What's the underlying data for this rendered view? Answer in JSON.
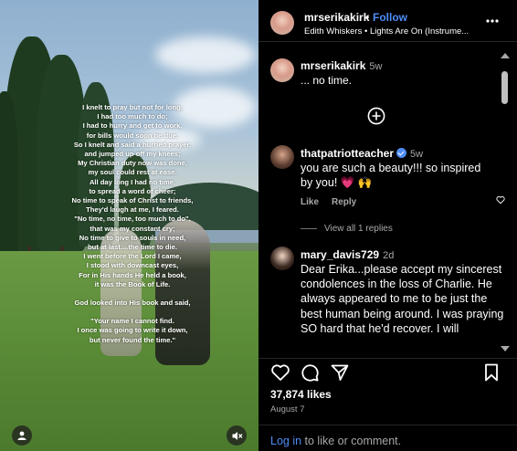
{
  "header": {
    "username": "mrserikakirk",
    "dot": "•",
    "follow_label": "Follow",
    "audio": "Edith Whiskers • Lights Are On (Instrume..."
  },
  "media": {
    "poem_lines": [
      "I knelt to pray but not for long,",
      "I had too much to do;",
      "I had to hurry and get to work,",
      "for bills would soon be due.",
      "So I knelt and said a hurried prayer,",
      "and jumped up off my knees;",
      "My Christian duty now was done,",
      "my soul could rest at ease.",
      "All day long I had no time,",
      "to spread a word of cheer;",
      "No time to speak of Christ to friends,",
      "They'd laugh at me, I feared.",
      "\"No time, no time, too much to do\",",
      "that was my constant cry;",
      "No time to give to souls in need,",
      "but at last....the time to die.",
      "I went before the Lord I came,",
      "I stood with downcast eyes,",
      "For in His hands He held a book,",
      "it was the Book of Life.",
      "",
      "God looked into His book and said,",
      "",
      "\"Your name I cannot find.",
      "I once was going to write it down,",
      "but never found the time.\""
    ]
  },
  "caption": {
    "username": "mrserikakirk",
    "time": "5w",
    "text": "... no time."
  },
  "comments": [
    {
      "username": "thatpatriotteacher",
      "verified": true,
      "time": "5w",
      "text": "you are such a beauty!!! so inspired by you! 💗 🙌",
      "like_label": "Like",
      "reply_label": "Reply",
      "view_replies": "View all 1 replies"
    },
    {
      "username": "mary_davis729",
      "time": "2d",
      "text": "Dear Erika...please accept my sincerest condolences in the loss of Charlie. He always appeared to me to be just the best human being around. I was praying SO hard that he'd recover. I will"
    }
  ],
  "footer": {
    "likes": "37,874 likes",
    "date": "August 7",
    "login_link": "Log in",
    "login_rest": " to like or comment."
  },
  "colors": {
    "accent": "#4f8cf6",
    "muted": "#a8a8a8",
    "background": "#000000"
  }
}
